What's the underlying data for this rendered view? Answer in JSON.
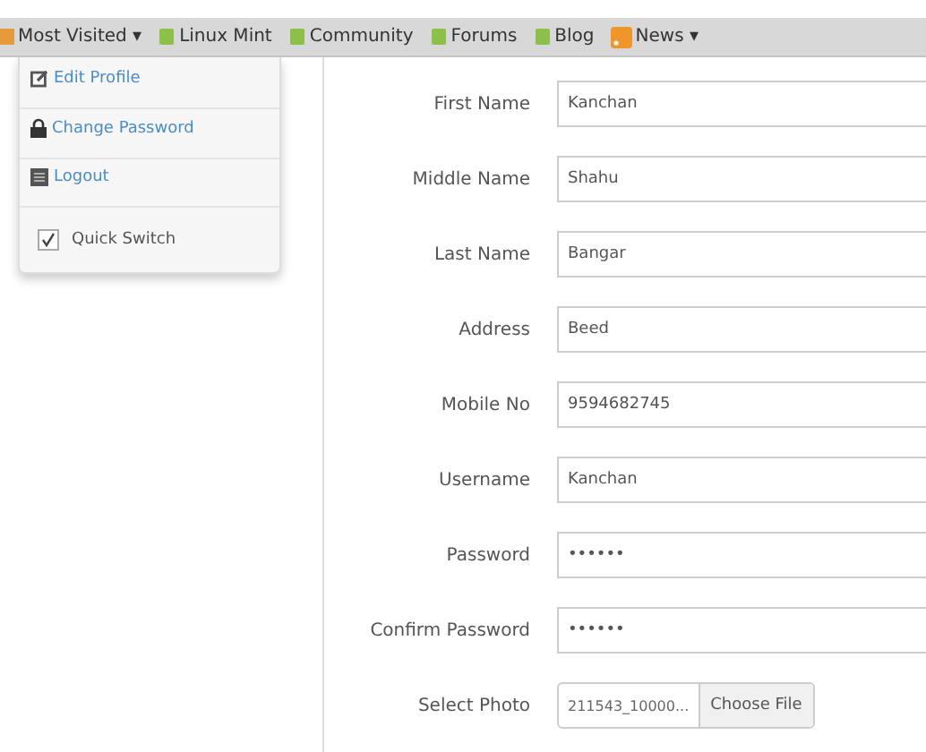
{
  "bookmarks": [
    {
      "label": "Most Visited ▾",
      "kind": "folder"
    },
    {
      "label": "Linux Mint",
      "kind": "leaf"
    },
    {
      "label": "Community",
      "kind": "leaf"
    },
    {
      "label": "Forums",
      "kind": "leaf"
    },
    {
      "label": "Blog",
      "kind": "leaf"
    },
    {
      "label": "News ▾",
      "kind": "feed"
    }
  ],
  "menu": {
    "items": [
      {
        "label": "Edit Profile",
        "kind": "edit"
      },
      {
        "label": "Change Password",
        "kind": "lock"
      },
      {
        "label": "Logout",
        "kind": "logout"
      }
    ],
    "quick_switch": {
      "label": "Quick Switch",
      "checked": true
    }
  },
  "form": {
    "fields": [
      {
        "label": "First Name",
        "value": "Kanchan",
        "kind": "text"
      },
      {
        "label": "Middle Name",
        "value": "Shahu",
        "kind": "text"
      },
      {
        "label": "Last Name",
        "value": "Bangar",
        "kind": "text"
      },
      {
        "label": "Address",
        "value": "Beed",
        "kind": "text"
      },
      {
        "label": "Mobile No",
        "value": "9594682745",
        "kind": "text"
      },
      {
        "label": "Username",
        "value": "Kanchan",
        "kind": "text"
      },
      {
        "label": "Password",
        "value": "••••••",
        "kind": "text"
      },
      {
        "label": "Confirm Password",
        "value": "••••••",
        "kind": "text"
      },
      {
        "label": "Select Photo",
        "value": "211543_10000...",
        "button": "Choose File",
        "kind": "file"
      }
    ]
  }
}
